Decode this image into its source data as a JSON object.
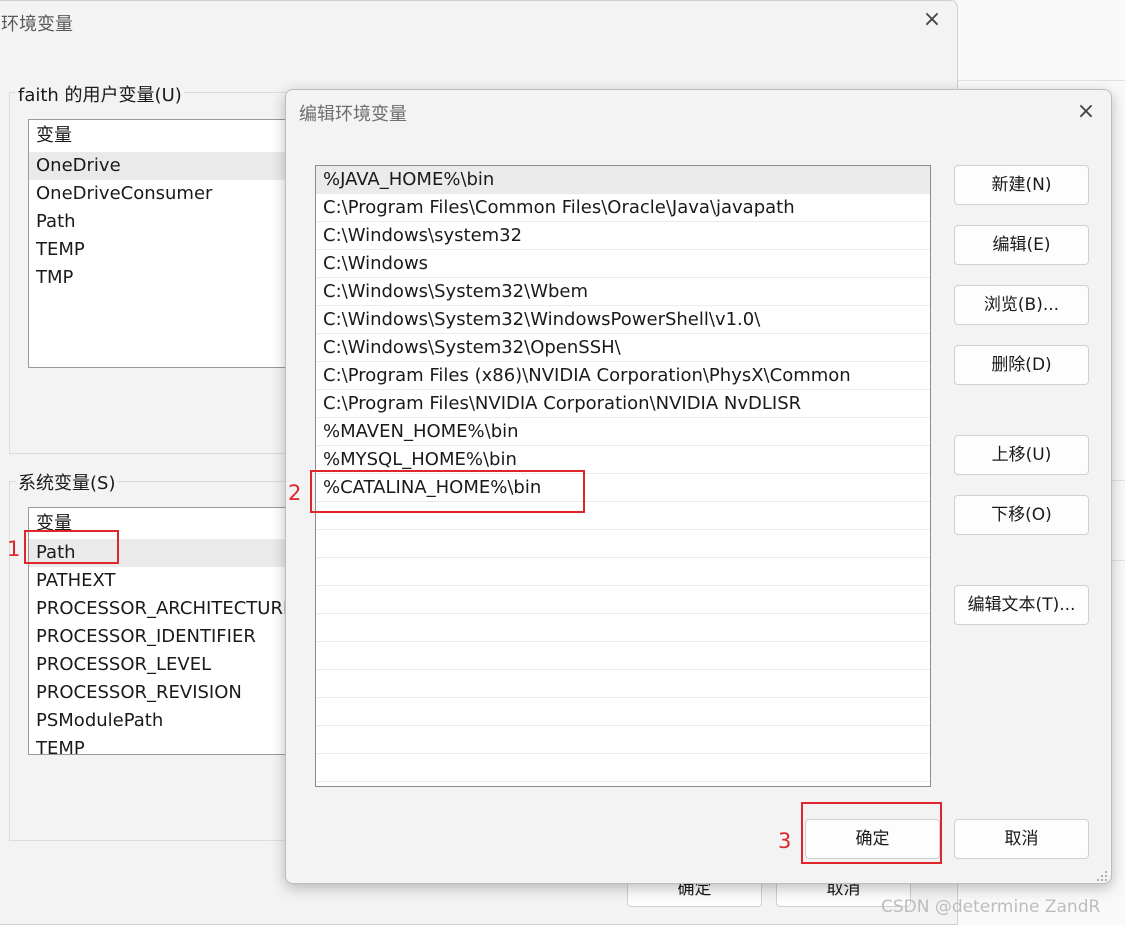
{
  "env_window": {
    "title": "环境变量",
    "close_icon": "×",
    "user_group_label": "faith 的用户变量(U)",
    "user_vars_header": "变量",
    "user_vars": [
      "OneDrive",
      "OneDriveConsumer",
      "Path",
      "TEMP",
      "TMP"
    ],
    "system_group_label": "系统变量(S)",
    "system_vars_header": "变量",
    "system_vars": [
      "Path",
      "PATHEXT",
      "PROCESSOR_ARCHITECTURE",
      "PROCESSOR_IDENTIFIER",
      "PROCESSOR_LEVEL",
      "PROCESSOR_REVISION",
      "PSModulePath",
      "TEMP"
    ],
    "ok_label": "确定",
    "cancel_label": "取消"
  },
  "edit_dialog": {
    "title": "编辑环境变量",
    "close_icon": "×",
    "paths": [
      "%JAVA_HOME%\\bin",
      "C:\\Program Files\\Common Files\\Oracle\\Java\\javapath",
      "C:\\Windows\\system32",
      "C:\\Windows",
      "C:\\Windows\\System32\\Wbem",
      "C:\\Windows\\System32\\WindowsPowerShell\\v1.0\\",
      "C:\\Windows\\System32\\OpenSSH\\",
      "C:\\Program Files (x86)\\NVIDIA Corporation\\PhysX\\Common",
      "C:\\Program Files\\NVIDIA Corporation\\NVIDIA NvDLISR",
      "%MAVEN_HOME%\\bin",
      "%MYSQL_HOME%\\bin",
      "%CATALINA_HOME%\\bin"
    ],
    "buttons": {
      "new": "新建(N)",
      "edit": "编辑(E)",
      "browse": "浏览(B)...",
      "delete": "删除(D)",
      "move_up": "上移(U)",
      "move_down": "下移(O)",
      "edit_text": "编辑文本(T)...",
      "ok": "确定",
      "cancel": "取消"
    }
  },
  "annotations": {
    "step1": "1",
    "step2": "2",
    "step3": "3",
    "color": "#e0262d"
  },
  "watermark": "CSDN @determine  ZandR"
}
